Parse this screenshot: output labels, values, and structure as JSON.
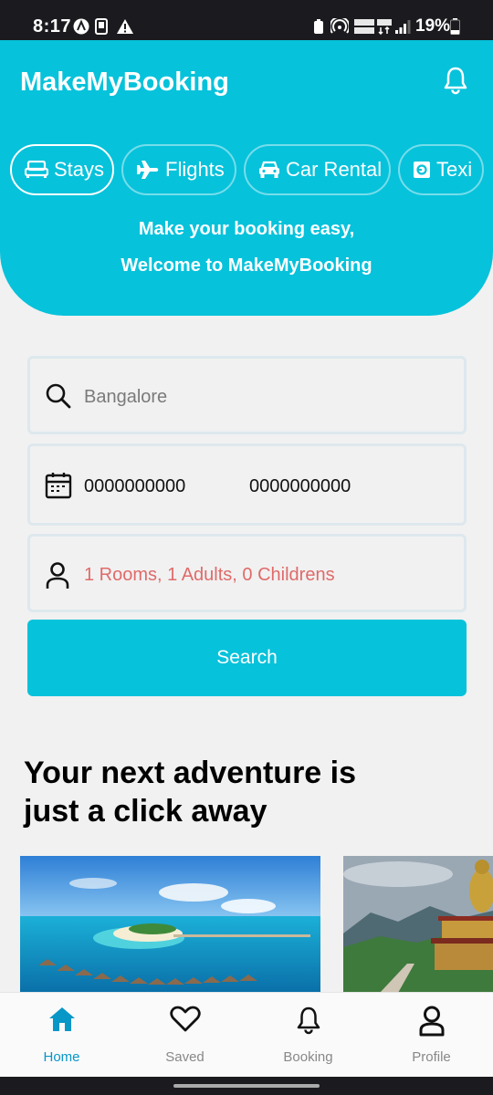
{
  "status_bar": {
    "time": "8:17",
    "battery": "19%"
  },
  "header": {
    "title": "MakeMyBooking"
  },
  "categories": [
    {
      "label": "Stays",
      "icon": "bed-icon",
      "active": true
    },
    {
      "label": "Flights",
      "icon": "plane-icon",
      "active": false
    },
    {
      "label": "Car Rental",
      "icon": "car-icon",
      "active": false
    },
    {
      "label": "Texi",
      "icon": "taxi-icon",
      "active": false
    }
  ],
  "welcome": {
    "line1": "Make your booking easy,",
    "line2": "Welcome to MakeMyBooking"
  },
  "search_form": {
    "location_value": "Bangalore",
    "date_start": "0000000000",
    "date_end": "0000000000",
    "guests": "1 Rooms, 1 Adults, 0 Childrens",
    "search_label": "Search"
  },
  "section": {
    "headline": "Your next adventure is just a click away"
  },
  "bottom_nav": [
    {
      "label": "Home",
      "icon": "home-icon",
      "active": true
    },
    {
      "label": "Saved",
      "icon": "heart-icon",
      "active": false
    },
    {
      "label": "Booking",
      "icon": "bell-icon",
      "active": false
    },
    {
      "label": "Profile",
      "icon": "user-icon",
      "active": false
    }
  ],
  "colors": {
    "primary": "#07c2db",
    "guests_text": "#e06a6a",
    "nav_active": "#0897c7"
  }
}
